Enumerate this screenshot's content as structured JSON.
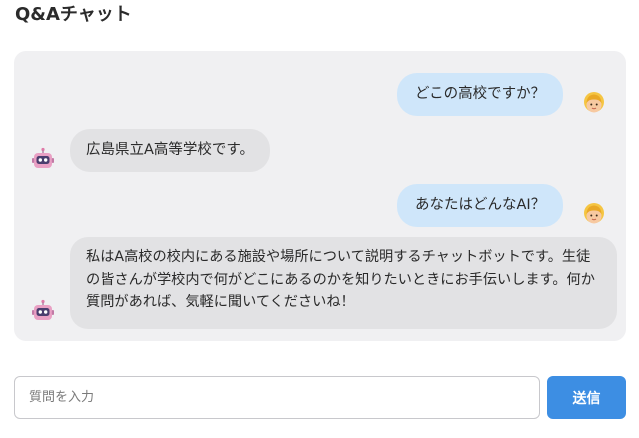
{
  "header": {
    "title": "Q&Aチャット"
  },
  "messages": [
    {
      "role": "user",
      "avatar": "girl-face-icon",
      "text": "どこの高校ですか？"
    },
    {
      "role": "bot",
      "avatar": "robot-face-icon",
      "text": "広島県立A高等学校です。"
    },
    {
      "role": "user",
      "avatar": "girl-face-icon",
      "text": "あなたはどんなAI？"
    },
    {
      "role": "bot",
      "avatar": "robot-face-icon",
      "text": "私はA高校の校内にある施設や場所について説明するチャットボットです。生徒の皆さんが学校内で何がどこにあるのかを知りたいときにお手伝いします。何か質問があれば、気軽に聞いてくださいね！"
    }
  ],
  "input": {
    "placeholder": "質問を入力",
    "value": ""
  },
  "send_button": {
    "label": "送信"
  },
  "colors": {
    "user_bubble": "#cfe6fa",
    "bot_bubble": "#e2e2e4",
    "panel": "#f0f0f2",
    "send_button": "#3d8ee3"
  }
}
